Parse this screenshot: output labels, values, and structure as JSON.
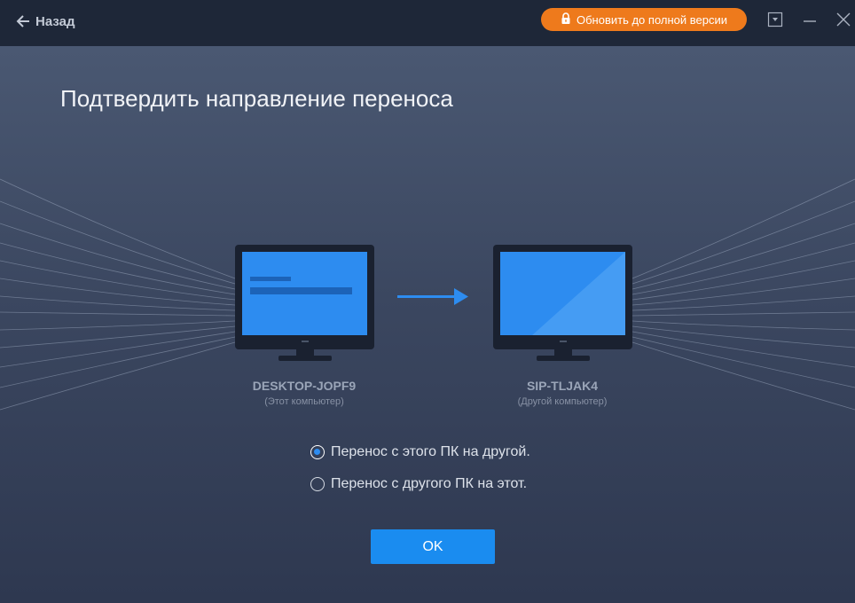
{
  "titlebar": {
    "back_label": "Назад",
    "upgrade_label": "Обновить до полной версии",
    "accent_color": "#ee7a1c"
  },
  "page": {
    "title": "Подтвердить направление переноса"
  },
  "source_pc": {
    "name": "DESKTOP-JOPF9",
    "subtitle": "(Этот компьютер)",
    "icon": "monitor-icon"
  },
  "target_pc": {
    "name": "SIP-TLJAK4",
    "subtitle": "(Другой компьютер)",
    "icon": "monitor-icon"
  },
  "direction_icon": "arrow-right-icon",
  "options": [
    {
      "label": "Перенос с этого ПК на другой.",
      "checked": true
    },
    {
      "label": "Перенос с другого ПК на этот.",
      "checked": false
    }
  ],
  "ok_label": "OK",
  "colors": {
    "primary": "#1a8cf0",
    "background": "#2f3a50",
    "titlebar": "#1e2738"
  }
}
